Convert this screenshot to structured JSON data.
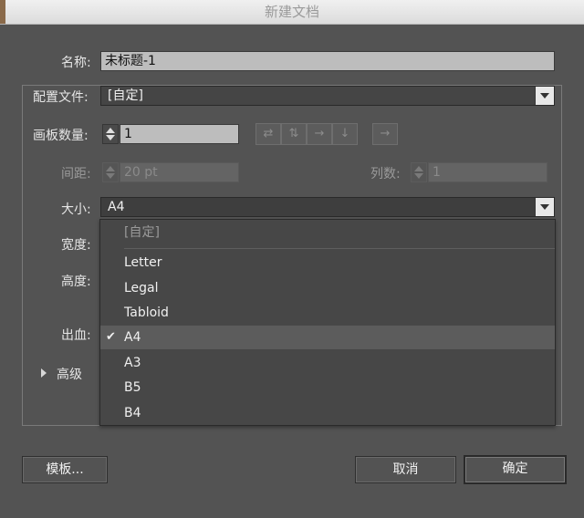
{
  "window": {
    "title": "新建文档"
  },
  "form": {
    "name_label": "名称:",
    "name_value": "未标题-1",
    "profile_label": "配置文件:",
    "profile_value": "[自定]",
    "artboards_label": "画板数量:",
    "artboards_value": "1",
    "spacing_label": "间距:",
    "spacing_value": "20 pt",
    "columns_label": "列数:",
    "columns_value": "1",
    "size_label": "大小:",
    "size_value": "A4",
    "width_label": "宽度:",
    "height_label": "高度:",
    "bleed_label": "出血:",
    "advanced_label": "高级"
  },
  "arrangement_icons": [
    "grid-by-row-icon",
    "grid-by-column-icon",
    "arrange-by-row-icon",
    "arrange-by-column-icon",
    "right-to-left-icon"
  ],
  "size_menu": {
    "custom": "[自定]",
    "items": [
      "Letter",
      "Legal",
      "Tabloid",
      "A4",
      "A3",
      "B5",
      "B4"
    ],
    "selected": "A4"
  },
  "buttons": {
    "templates": "模板...",
    "cancel": "取消",
    "ok": "确定"
  }
}
